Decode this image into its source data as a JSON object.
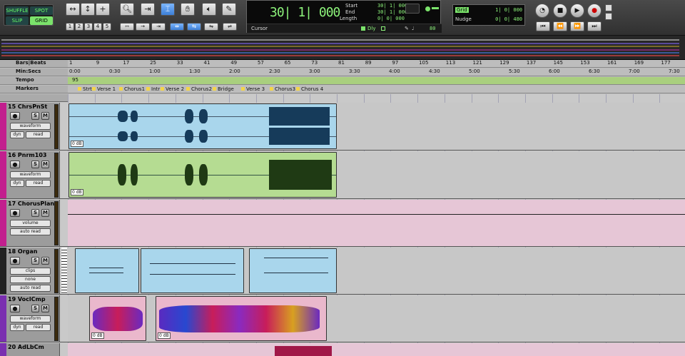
{
  "toolbar": {
    "modes": {
      "shuffle": "SHUFFLE",
      "spot": "SPOT",
      "slip": "SLIP",
      "grid": "GRID"
    },
    "zoom_presets": [
      "1",
      "2",
      "3",
      "4",
      "5"
    ]
  },
  "counter": {
    "main": "30| 1| 000",
    "start_label": "Start",
    "start_value": "30| 1| 000",
    "end_label": "End",
    "end_value": "30| 1| 000",
    "length_label": "Length",
    "length_value": "0| 0| 000",
    "cursor_label": "Cursor",
    "dly_label": "Dly",
    "tempo_value": "80"
  },
  "grid": {
    "grid_label": "Grid",
    "grid_value": "1| 0| 000",
    "nudge_label": "Nudge",
    "nudge_value": "0| 0| 480"
  },
  "rulers": {
    "bars_label": "Bars|Beats",
    "minsec_label": "Min:Secs",
    "tempo_label": "Tempo",
    "markers_label": "Markers",
    "bars": [
      "1",
      "9",
      "17",
      "25",
      "33",
      "41",
      "49",
      "57",
      "65",
      "73",
      "81",
      "89",
      "97",
      "105",
      "113",
      "121",
      "129",
      "137",
      "145",
      "153",
      "161",
      "169",
      "177"
    ],
    "minsecs": [
      "0:00",
      "0:30",
      "1:00",
      "1:30",
      "2:00",
      "2:30",
      "3:00",
      "3:30",
      "4:00",
      "4:30",
      "5:00",
      "5:30",
      "6:00",
      "6:30",
      "7:00",
      "7:30"
    ],
    "tempo": "95",
    "markers": [
      "Strt",
      "Verse 1",
      "Chorus1",
      "Intr",
      "Verse 2",
      "Chorus2",
      "Bridge",
      "Verse 3",
      "Chorus3",
      "Chorus 4"
    ]
  },
  "tracks": [
    {
      "name": "15 ChrsPnSt",
      "view": "waveform",
      "auto1": "dyn",
      "auto2": "read",
      "gain": "0 dB",
      "color": "#c21f8e"
    },
    {
      "name": "16 Pnrm103",
      "view": "waveform",
      "auto1": "dyn",
      "auto2": "read",
      "gain": "0 dB",
      "color": "#c21f8e"
    },
    {
      "name": "17 ChorusPlan",
      "view": "volume",
      "auto2": "auto read",
      "color": "#c21f8e"
    },
    {
      "name": "18 Organ",
      "view": "clips",
      "auto1": "none",
      "auto2": "auto read",
      "color": "#222222"
    },
    {
      "name": "19 VoclCmp",
      "view": "waveform",
      "auto1": "dyn",
      "auto2": "read",
      "gain": "0 dB",
      "color": "#7a2fb0"
    },
    {
      "name": "20 AdLbCm",
      "color": "#7a2fb0"
    }
  ],
  "colors": {
    "audio_blue": "#a9d6ec",
    "audio_green": "#b5dc92",
    "pink_lane": "#e6c6d6",
    "vocal_pink": "#eab8cc",
    "counter_green": "#8cf27a",
    "marker_yellow": "#f3d44a"
  }
}
